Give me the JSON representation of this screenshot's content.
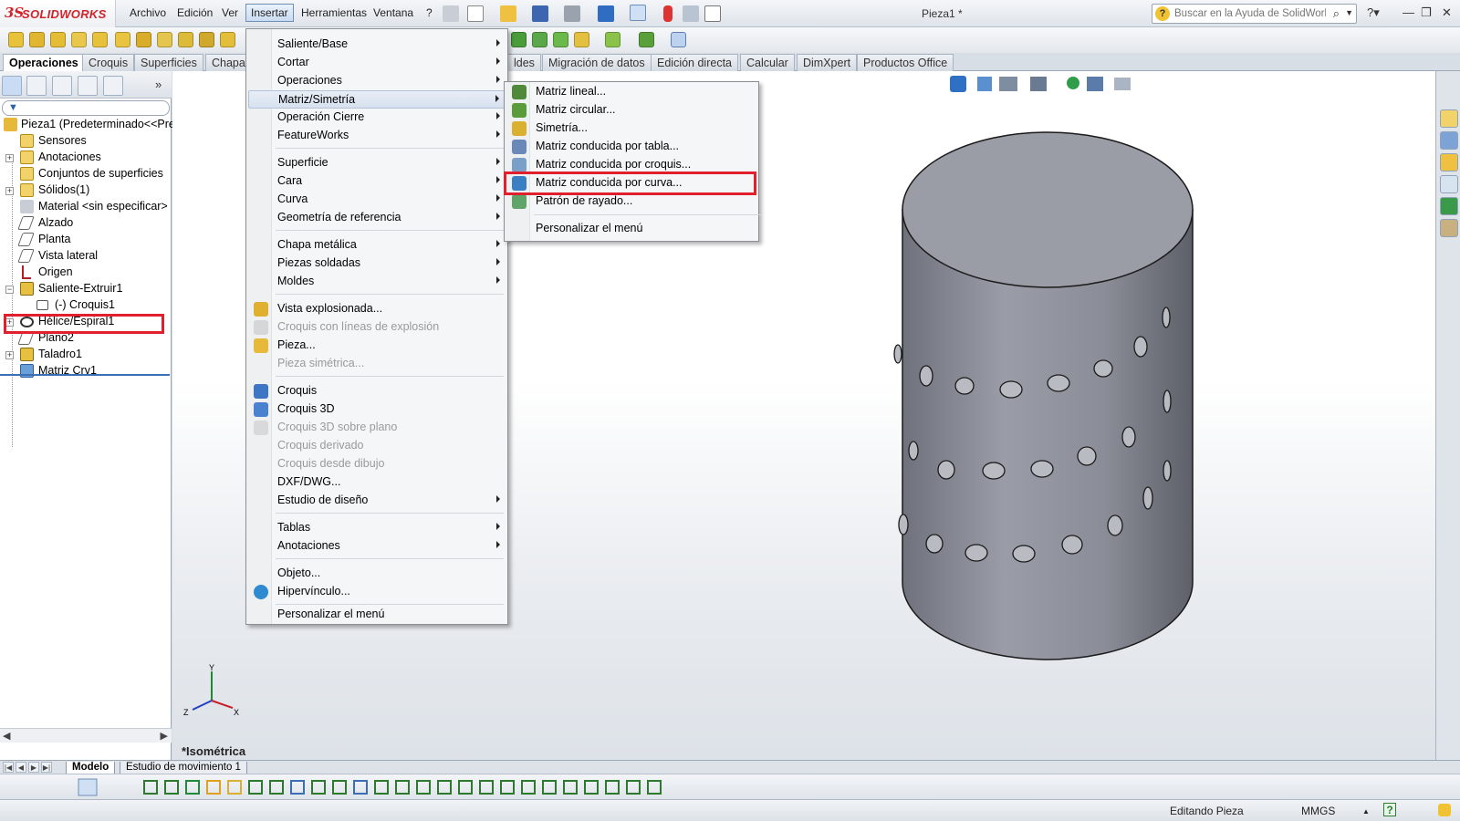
{
  "app": {
    "logo_ds": "3S",
    "logo_text": "SOLIDWORKS",
    "document_title": "Pieza1 *"
  },
  "menubar": [
    "Archivo",
    "Edición",
    "Ver",
    "Insertar",
    "Herramientas",
    "Ventana",
    "?"
  ],
  "help_search": {
    "placeholder": "Buscar en la Ayuda de SolidWorks"
  },
  "command_tabs": [
    "Operaciones",
    "Croquis",
    "Superficies",
    "Chapa",
    "ldes",
    "Migración de datos",
    "Edición directa",
    "Calcular",
    "DimXpert",
    "Productos Office"
  ],
  "feature_tree": {
    "root": "Pieza1  (Predeterminado<<Pre",
    "items": [
      "Sensores",
      "Anotaciones",
      "Conjuntos de superficies",
      "Sólidos(1)",
      "Material <sin especificar>",
      "Alzado",
      "Planta",
      "Vista lateral",
      "Origen",
      "Saliente-Extruir1",
      "(-) Croquis1",
      "Hélice/Espiral1",
      "Plano2",
      "Taladro1",
      "Matriz Crv1"
    ]
  },
  "insert_menu": {
    "items": [
      {
        "label": "Saliente/Base",
        "submenu": true
      },
      {
        "label": "Cortar",
        "submenu": true
      },
      {
        "label": "Operaciones",
        "submenu": true
      },
      {
        "label": "Matriz/Simetría",
        "submenu": true,
        "highlighted": true
      },
      {
        "label": "Operación Cierre",
        "submenu": true
      },
      {
        "label": "FeatureWorks",
        "submenu": true
      },
      {
        "label": "Superficie",
        "submenu": true
      },
      {
        "label": "Cara",
        "submenu": true
      },
      {
        "label": "Curva",
        "submenu": true
      },
      {
        "label": "Geometría de referencia",
        "submenu": true
      },
      {
        "label": "Chapa metálica",
        "submenu": true
      },
      {
        "label": "Piezas soldadas",
        "submenu": true
      },
      {
        "label": "Moldes",
        "submenu": true
      },
      {
        "label": "Vista explosionada...",
        "enabled": true
      },
      {
        "label": "Croquis con líneas de explosión",
        "enabled": false
      },
      {
        "label": "Pieza...",
        "enabled": true
      },
      {
        "label": "Pieza simétrica...",
        "enabled": false
      },
      {
        "label": "Croquis",
        "enabled": true
      },
      {
        "label": "Croquis 3D",
        "enabled": true
      },
      {
        "label": "Croquis 3D sobre plano",
        "enabled": false
      },
      {
        "label": "Croquis derivado",
        "enabled": false
      },
      {
        "label": "Croquis desde dibujo",
        "enabled": false
      },
      {
        "label": "DXF/DWG...",
        "enabled": true
      },
      {
        "label": "Estudio de diseño",
        "submenu": true
      },
      {
        "label": "Tablas",
        "submenu": true
      },
      {
        "label": "Anotaciones",
        "submenu": true
      },
      {
        "label": "Objeto...",
        "enabled": true
      },
      {
        "label": "Hipervínculo...",
        "enabled": true
      },
      {
        "label": "Personalizar el menú",
        "enabled": true
      }
    ]
  },
  "pattern_submenu": {
    "items": [
      "Matriz lineal...",
      "Matriz circular...",
      "Simetría...",
      "Matriz conducida por tabla...",
      "Matriz conducida por croquis...",
      "Matriz conducida por curva...",
      "Patrón de rayado...",
      "Personalizar el menú"
    ],
    "selected": "Matriz conducida por curva..."
  },
  "viewport": {
    "view_name": "*Isométrica",
    "triad_x": "X",
    "triad_y": "Y",
    "triad_z": "Z",
    "part_color": "#8f929c",
    "highlight_color": "#e0202c"
  },
  "bottom_tabs": [
    "Modelo",
    "Estudio de movimiento 1"
  ],
  "statusbar": {
    "mode": "Editando Pieza",
    "units": "MMGS",
    "units_arrow": "▲",
    "help": "?"
  }
}
